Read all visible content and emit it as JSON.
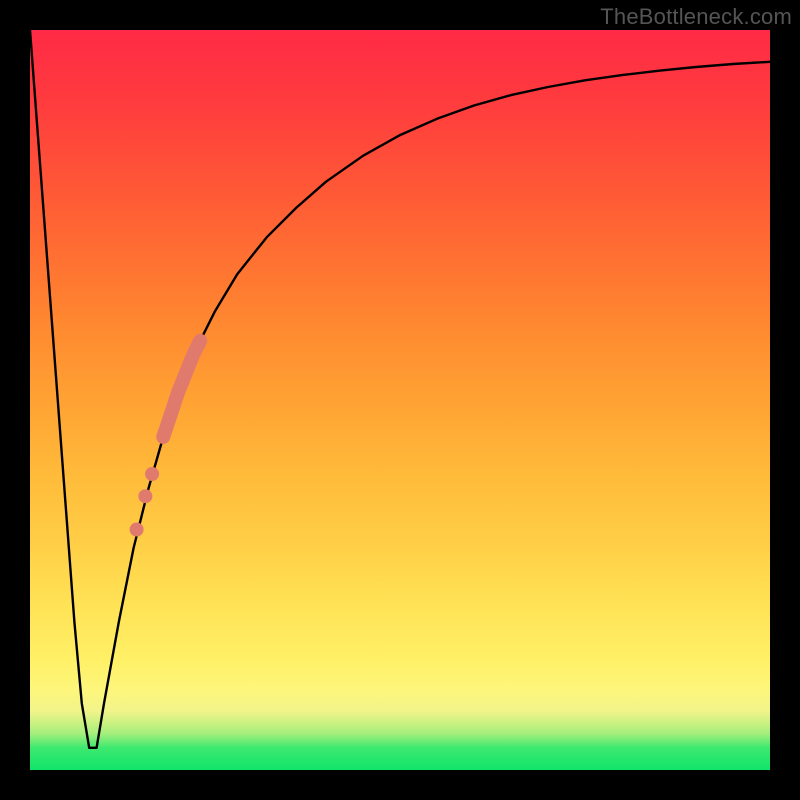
{
  "watermark": "TheBottleneck.com",
  "chart_data": {
    "type": "line",
    "title": "",
    "xlabel": "",
    "ylabel": "",
    "xlim": [
      0,
      100
    ],
    "ylim": [
      0,
      100
    ],
    "grid": false,
    "legend": false,
    "series": [
      {
        "name": "bottleneck-curve",
        "x": [
          0,
          3,
          6,
          7,
          8,
          9,
          10,
          12,
          14,
          16,
          18,
          20,
          22,
          25,
          28,
          32,
          36,
          40,
          45,
          50,
          55,
          60,
          65,
          70,
          75,
          80,
          85,
          90,
          95,
          100
        ],
        "values": [
          100,
          60,
          20,
          9,
          3,
          3,
          9,
          20,
          30,
          38,
          45,
          51,
          56,
          62,
          67,
          72,
          76,
          79.5,
          83,
          85.8,
          88,
          89.8,
          91.2,
          92.3,
          93.2,
          93.9,
          94.5,
          95,
          95.4,
          95.7
        ]
      }
    ],
    "markers": [
      {
        "name": "confidence-band",
        "type": "thick-segment",
        "x_range": [
          18,
          23
        ],
        "y_range": [
          45,
          58
        ]
      },
      {
        "name": "dot-1",
        "type": "dot",
        "x": 16.5,
        "y": 40
      },
      {
        "name": "dot-2",
        "type": "dot",
        "x": 15.6,
        "y": 37
      },
      {
        "name": "dot-3",
        "type": "dot",
        "x": 14.4,
        "y": 32.5
      }
    ],
    "colors": {
      "curve": "#000000",
      "markers": "#e07a6d",
      "frame": "#000000"
    }
  }
}
